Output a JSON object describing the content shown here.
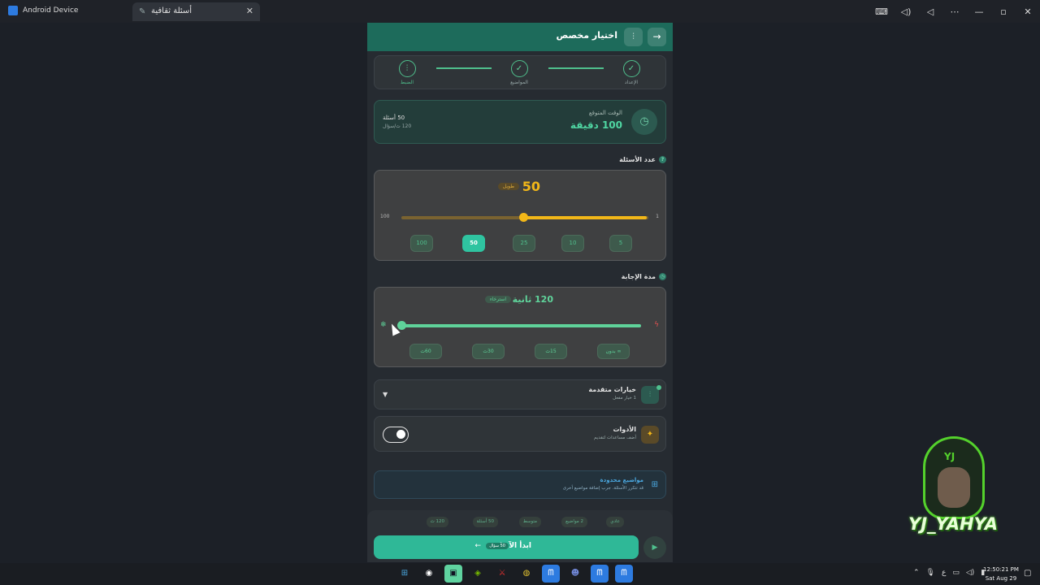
{
  "window": {
    "app_title": "Android Device",
    "tab_label": "أسئلة ثقافية",
    "controls": {
      "minimize": "—",
      "restore": "▫",
      "close": "✕"
    }
  },
  "header": {
    "title": "اختيار مخصص"
  },
  "stepper": {
    "steps": [
      {
        "label": "الإعداد",
        "state": "done"
      },
      {
        "label": "المواضيع",
        "state": "done"
      },
      {
        "label": "الضبط",
        "state": "active"
      }
    ]
  },
  "estimate": {
    "label": "الوقت المتوقع",
    "value": "100 دقيقة",
    "questions": "50 أسئلة",
    "per_question": "120 ث/سؤال"
  },
  "question_count": {
    "section_title": "عدد الأسئلة",
    "value": "50",
    "badge": "طويل",
    "min_label": "1",
    "max_label": "100",
    "slider_value": 50,
    "slider_min": 1,
    "slider_max": 100,
    "presets": [
      "5",
      "10",
      "25",
      "50",
      "100"
    ],
    "selected_preset": "50"
  },
  "answer_time": {
    "section_title": "مدة الإجابة",
    "value": "120 ثانية",
    "badge": "استرخاء",
    "presets": [
      "∞ بدون",
      "15ث",
      "30ث",
      "60ث"
    ]
  },
  "advanced": {
    "title": "خيارات متقدمة",
    "subtitle": "1 خيار مفعل"
  },
  "tools": {
    "title": "الأدوات",
    "subtitle": "أضف مساعدات لتقديم",
    "toggle_on": true
  },
  "topics_notice": {
    "title": "مواضيع محدودة",
    "subtitle": "قد تتكرر الأسئلة. جرب إضافة مواضيع أخرى"
  },
  "footer": {
    "meta": [
      "عادي",
      "2 مواضيع",
      "متوسط",
      "50 أسئلة",
      "120 ث"
    ],
    "start_label": "ابدأ الآن!",
    "start_badge": "50 سؤال"
  },
  "branding": {
    "logo_text": "YJ_YAHYA"
  },
  "taskbar": {
    "time": "12:50:21 PM",
    "date": "Sat Aug 29",
    "input_lang": "ع"
  },
  "colors": {
    "accent_green": "#4fc08d",
    "accent_yellow": "#f2b718",
    "header_bg": "#1d6b5b",
    "start_button": "#2fb897"
  }
}
